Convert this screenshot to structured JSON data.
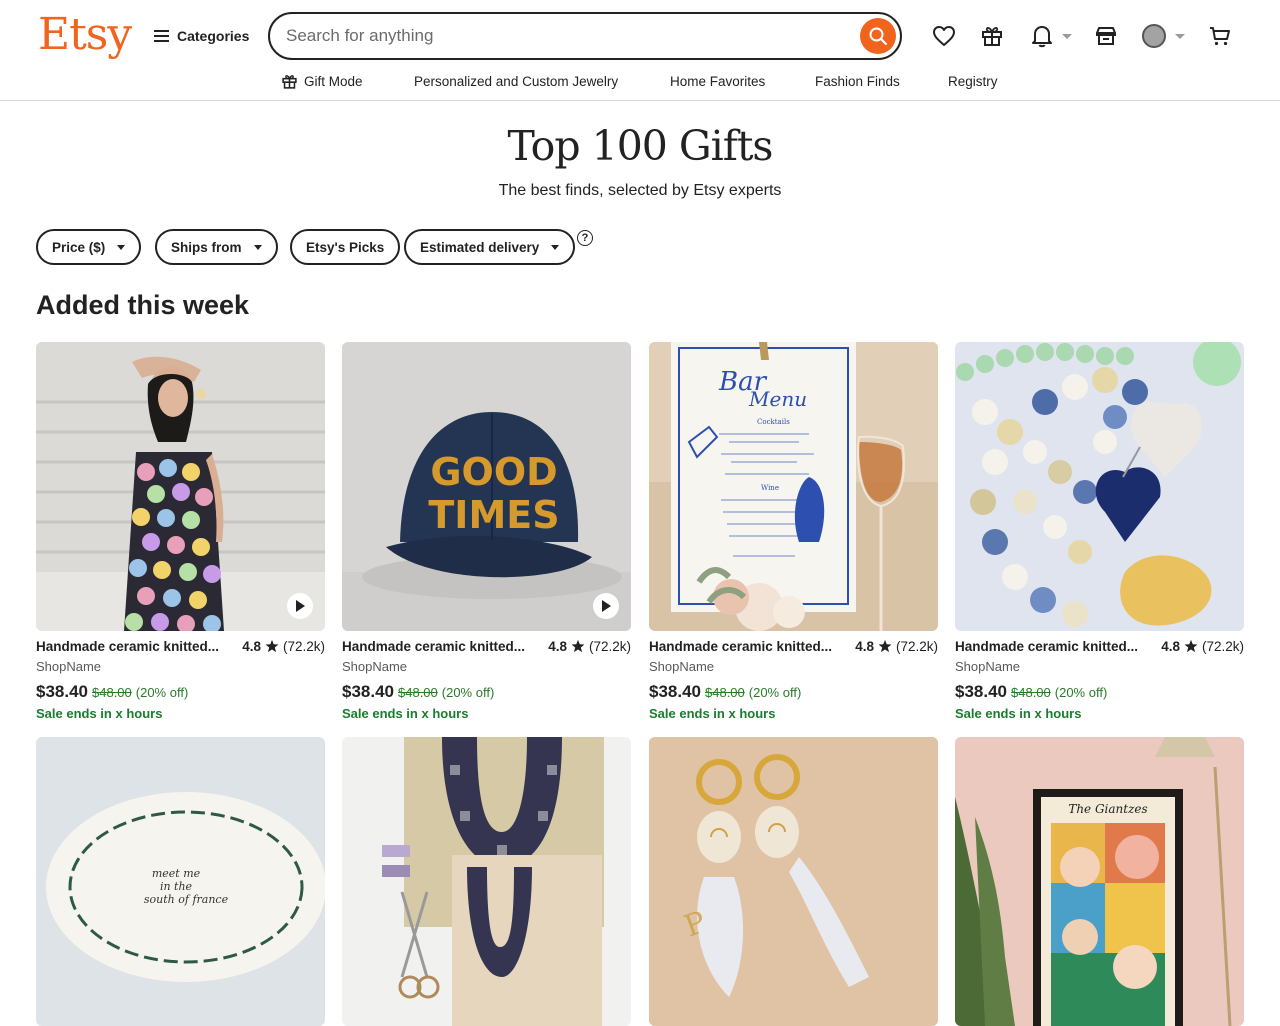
{
  "header": {
    "logo": "Etsy",
    "categories_label": "Categories",
    "search_placeholder": "Search for anything",
    "brand_color": "#f1641e"
  },
  "nav": {
    "items": [
      {
        "label": "Gift Mode",
        "icon": "gift-icon"
      },
      {
        "label": "Personalized and Custom Jewelry"
      },
      {
        "label": "Home Favorites"
      },
      {
        "label": "Fashion Finds"
      },
      {
        "label": "Registry"
      }
    ]
  },
  "hero": {
    "title": "Top 100 Gifts",
    "subtitle": "The best finds, selected by Etsy experts"
  },
  "filters": [
    {
      "label": "Price ($)",
      "dropdown": true
    },
    {
      "label": "Ships from",
      "dropdown": true
    },
    {
      "label": "Etsy's Picks",
      "dropdown": false
    },
    {
      "label": "Estimated delivery",
      "dropdown": true
    }
  ],
  "help_glyph": "?",
  "section": {
    "title": "Added this week"
  },
  "products": [
    {
      "image": "patterned-dress-photo",
      "title": "Handmade ceramic knitted...",
      "rating": "4.8",
      "reviews": "(72.2k)",
      "shop": "ShopName",
      "price": "$38.40",
      "original_price": "$48.00",
      "discount": "(20% off)",
      "sale": "Sale ends in x hours",
      "video": true
    },
    {
      "image": "good-times-cap-photo",
      "title": "Handmade ceramic knitted...",
      "rating": "4.8",
      "reviews": "(72.2k)",
      "shop": "ShopName",
      "price": "$38.40",
      "original_price": "$48.00",
      "discount": "(20% off)",
      "sale": "Sale ends in x hours",
      "video": true
    },
    {
      "image": "bar-menu-photo",
      "title": "Handmade ceramic knitted...",
      "rating": "4.8",
      "reviews": "(72.2k)",
      "shop": "ShopName",
      "price": "$38.40",
      "original_price": "$48.00",
      "discount": "(20% off)",
      "sale": "Sale ends in x hours",
      "video": false
    },
    {
      "image": "gemstone-bracelets-photo",
      "title": "Handmade ceramic knitted...",
      "rating": "4.8",
      "reviews": "(72.2k)",
      "shop": "ShopName",
      "price": "$38.40",
      "original_price": "$48.00",
      "discount": "(20% off)",
      "sale": "Sale ends in x hours",
      "video": false
    },
    {
      "image": "ceramic-plate-photo"
    },
    {
      "image": "horseshoe-quilt-photo"
    },
    {
      "image": "fish-earrings-photo"
    },
    {
      "image": "framed-poster-photo"
    }
  ],
  "image_text": {
    "cap": [
      "GOOD",
      "TIMES"
    ],
    "menu": [
      "Bar",
      "Menu",
      "Cocktails",
      "Wine"
    ],
    "plate": [
      "meet me",
      "in the",
      "south of france"
    ],
    "poster": "The Giantzes"
  }
}
